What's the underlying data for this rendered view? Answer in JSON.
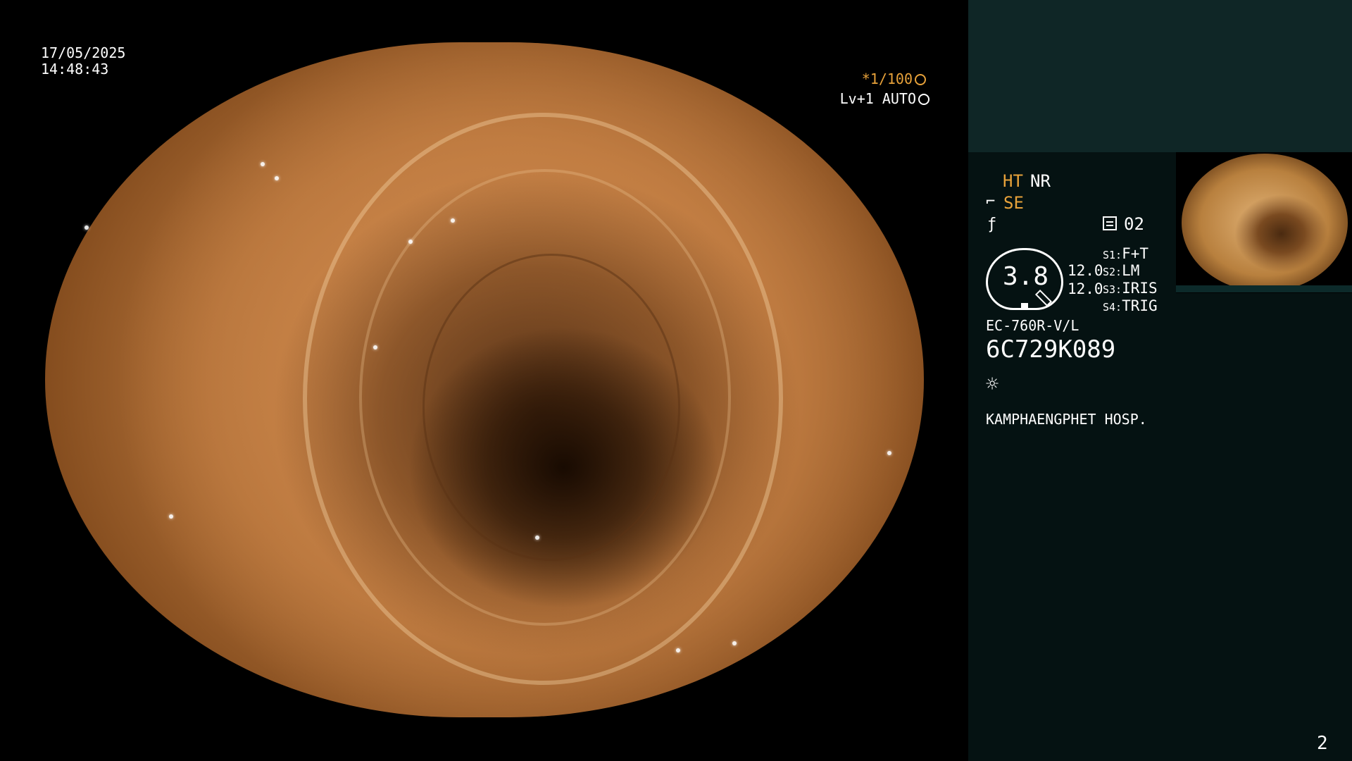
{
  "overlay": {
    "date": "17/05/2025",
    "time": "14:48:43",
    "shutter": "*1/100",
    "level": "Lv+1 AUTO"
  },
  "panel": {
    "ht": "HT",
    "nr": "NR",
    "se": "SE",
    "record_count": "02",
    "gauge_value": "3.8",
    "gauge_right_1": "12.0",
    "gauge_right_2": "12.0",
    "switches": [
      {
        "key": "S1:",
        "value": "F+T"
      },
      {
        "key": "S2:",
        "value": "LM"
      },
      {
        "key": "S3:",
        "value": "IRIS"
      },
      {
        "key": "S4:",
        "value": "TRIG"
      }
    ],
    "scope_model": "EC-760R-V/L",
    "scope_serial": "6C729K089",
    "hospital": "KAMPHAENGPHET HOSP.",
    "page_number": "2"
  },
  "icons": {
    "shutter_icon": "aperture-icon",
    "level_icon": "iris-icon",
    "se_icon": "structure-enhance-icon",
    "fn_icon": "function-icon",
    "record_icon": "record-list-icon",
    "light_icon": "sun-icon"
  },
  "colors": {
    "accent_orange": "#e8a23a",
    "panel_top": "#0f2626",
    "panel": "#051212"
  }
}
